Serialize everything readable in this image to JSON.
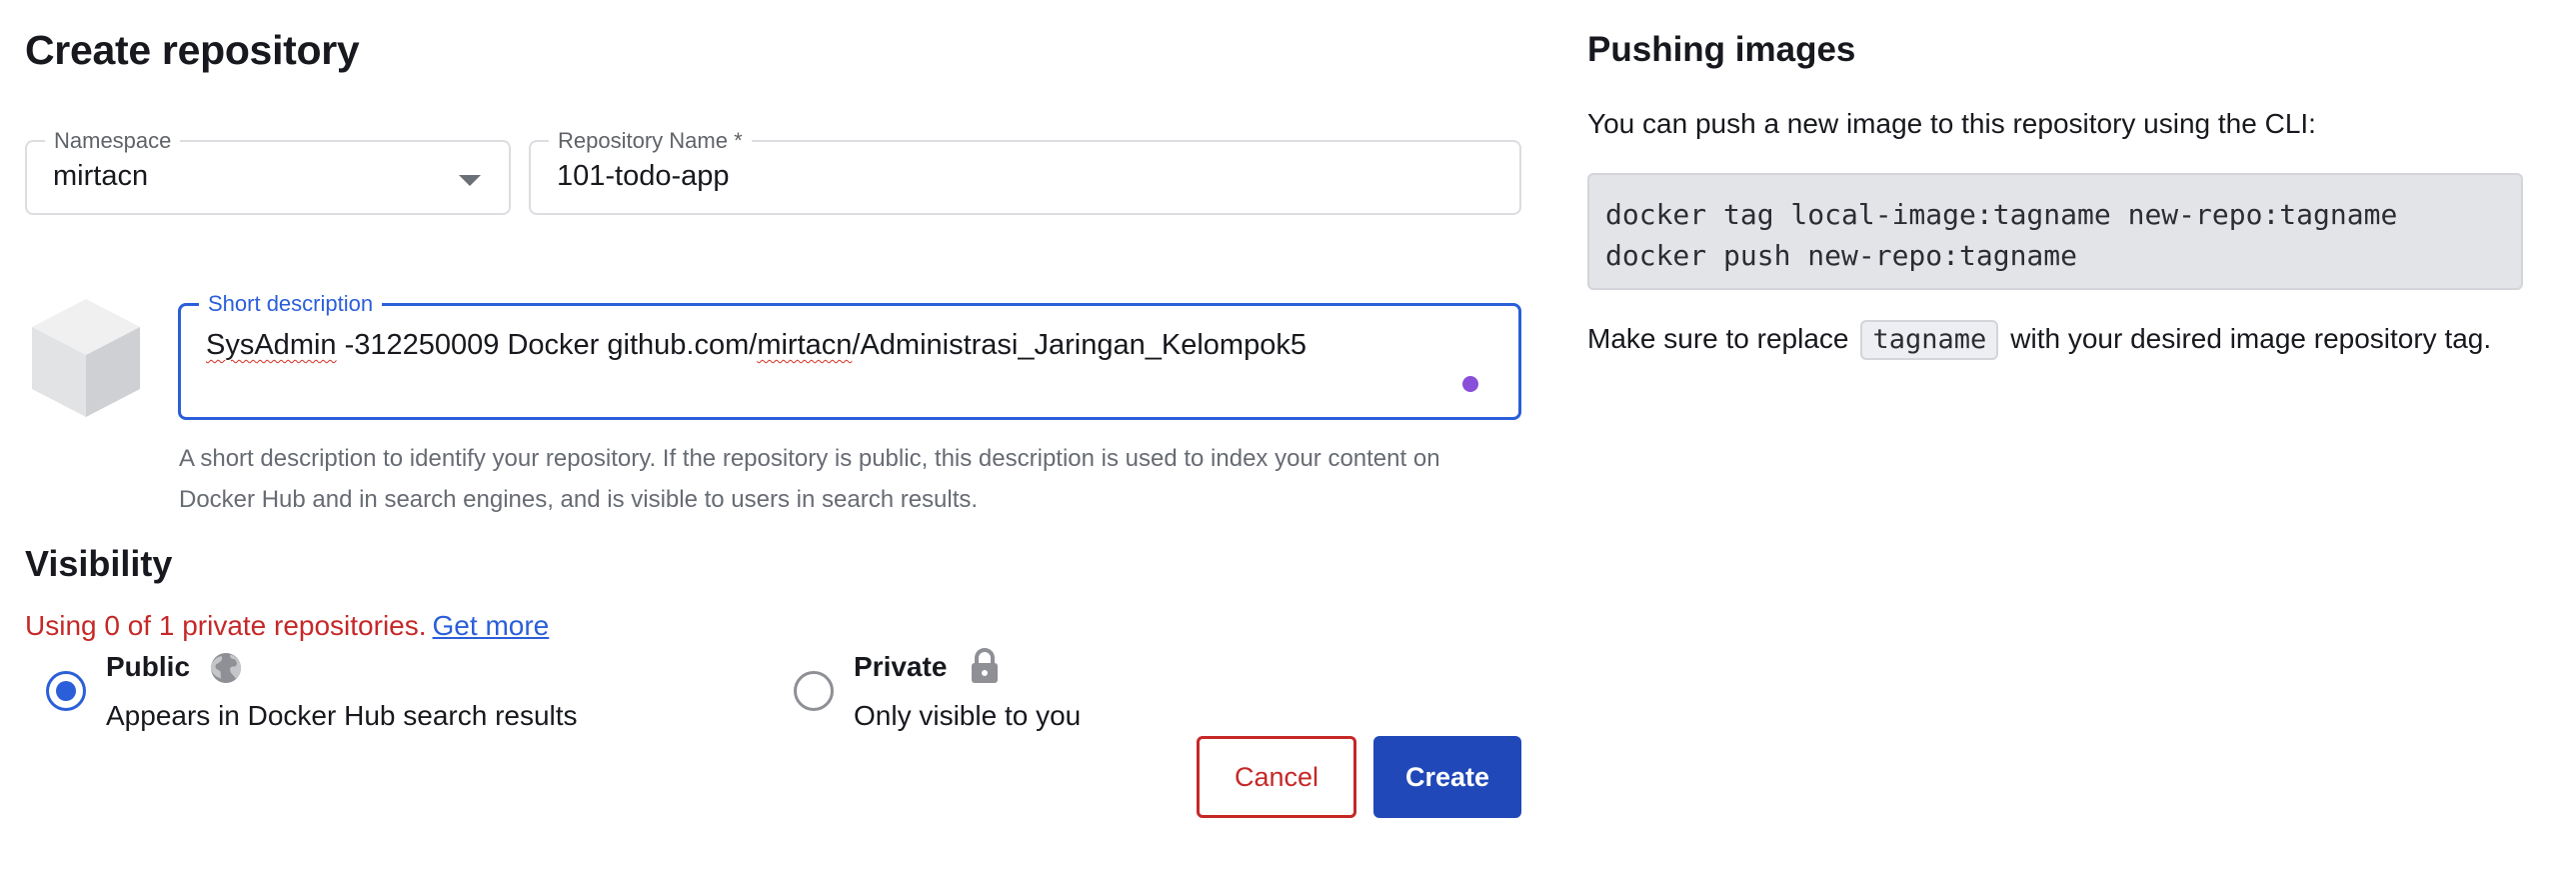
{
  "form": {
    "title": "Create repository",
    "namespace": {
      "label": "Namespace",
      "value": "mirtacn"
    },
    "repository_name": {
      "label": "Repository Name *",
      "value": "101-todo-app"
    },
    "short_description": {
      "label": "Short description",
      "value_part1": "SysAdmin",
      "value_part2": " -312250009 Docker github.com/",
      "value_part3": "mirtacn",
      "value_part4": "/Administrasi_Jaringan_Kelompok5",
      "helper": "A short description to identify your repository. If the repository is public, this description is used to index your content on Docker Hub and in search engines, and is visible to users in search results."
    },
    "visibility": {
      "title": "Visibility",
      "usage_text": "Using 0 of 1 private repositories.",
      "usage_link": "Get more",
      "public": {
        "title": "Public",
        "description": "Appears in Docker Hub search results",
        "selected": true
      },
      "private": {
        "title": "Private",
        "description": "Only visible to you",
        "selected": false
      }
    },
    "cancel_label": "Cancel",
    "create_label": "Create"
  },
  "sidebar": {
    "title": "Pushing images",
    "intro": "You can push a new image to this repository using the CLI:",
    "code_lines": "docker tag local-image:tagname new-repo:tagname\ndocker push new-repo:tagname",
    "note_before": "Make sure to replace",
    "note_code": "tagname",
    "note_after": "with your desired image repository tag."
  },
  "icons": {
    "namespace_dropdown": "chevron-down-icon",
    "repo": "cube-icon",
    "public": "globe-icon",
    "private": "lock-icon"
  },
  "colors": {
    "primary": "#2048b8",
    "focus": "#2b5fd9",
    "danger": "#c62828"
  }
}
